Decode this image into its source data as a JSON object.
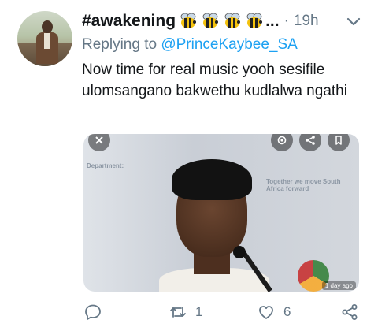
{
  "tweet": {
    "display_name": "#awakening",
    "name_emoji": [
      "bee",
      "bee",
      "bee",
      "bee"
    ],
    "ellipsis": "...",
    "separator": "·",
    "time": "19h",
    "reply_prefix": "Replying to",
    "reply_handle": "@PrinceKaybee_SA",
    "text": "Now time for real music yooh sesifile ulomsangano bakwethu  kudlalwa ngathi",
    "media": {
      "background_text_1": "Department:",
      "background_text_2": "Together we move South Africa forward",
      "timestamp_badge": "1 day ago"
    },
    "actions": {
      "reply_count": "",
      "retweet_count": "1",
      "like_count": "6"
    }
  },
  "colors": {
    "text": "#14171a",
    "secondary": "#657786",
    "link": "#1da1f2"
  }
}
